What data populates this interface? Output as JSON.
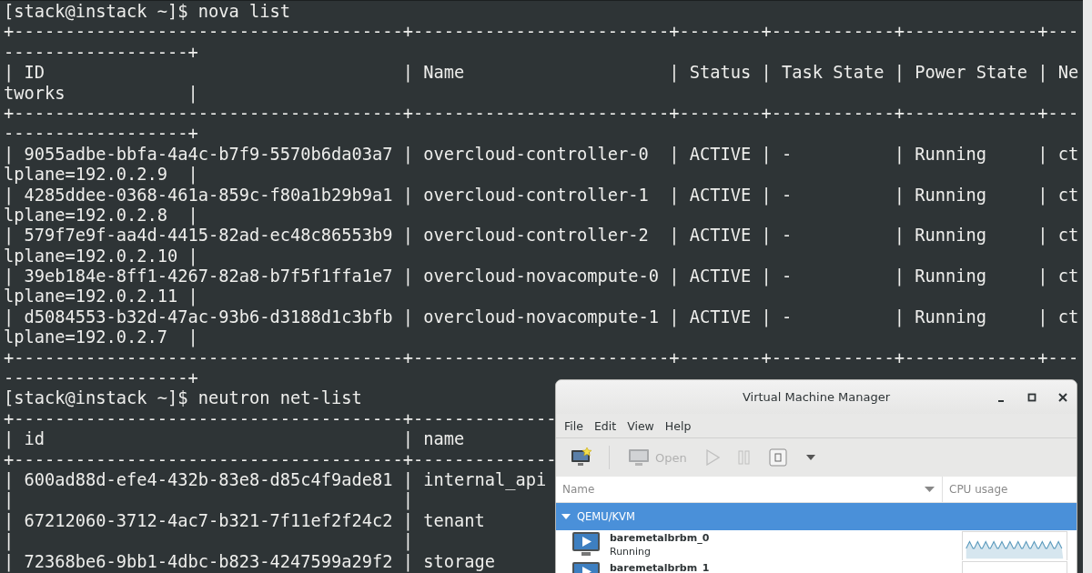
{
  "terminal": {
    "lines": [
      "[stack@instack ~]$ nova list",
      "+--------------------------------------+-------------------------+--------+------------+-------------+---",
      "------------------+",
      "| ID                                   | Name                    | Status | Task State | Power State | Ne",
      "tworks            |",
      "+--------------------------------------+-------------------------+--------+------------+-------------+---",
      "------------------+",
      "| 9055adbe-bbfa-4a4c-b7f9-5570b6da03a7 | overcloud-controller-0  | ACTIVE | -          | Running     | ct",
      "lplane=192.0.2.9  |",
      "| 4285ddee-0368-461a-859c-f80a1b29b9a1 | overcloud-controller-1  | ACTIVE | -          | Running     | ct",
      "lplane=192.0.2.8  |",
      "| 579f7e9f-aa4d-4415-82ad-ec48c86553b9 | overcloud-controller-2  | ACTIVE | -          | Running     | ct",
      "lplane=192.0.2.10 |",
      "| 39eb184e-8ff1-4267-82a8-b7f5f1ffa1e7 | overcloud-novacompute-0 | ACTIVE | -          | Running     | ct",
      "lplane=192.0.2.11 |",
      "| d5084553-b32d-47ac-93b6-d3188d1c3bfb | overcloud-novacompute-1 | ACTIVE | -          | Running     | ct",
      "lplane=192.0.2.7  |",
      "+--------------------------------------+-------------------------+--------+------------+-------------+---",
      "------------------+",
      "[stack@instack ~]$ neutron net-list",
      "+--------------------------------------+--------------",
      "| id                                   | name",
      "+--------------------------------------+--------------",
      "| 600ad88d-efe4-432b-83e8-d85c4f9ade81 | internal_api",
      "|                                      |",
      "| 67212060-3712-4ac7-b321-7f11ef2f24c2 | tenant",
      "|                                      |",
      "| 72368be6-9bb1-4dbc-b823-4247599a29f2 | storage"
    ]
  },
  "vmm_window": {
    "title": "Virtual Machine Manager",
    "menu": [
      "File",
      "Edit",
      "View",
      "Help"
    ],
    "toolbar": [
      {
        "kind": "new",
        "disabled": false
      },
      {
        "kind": "open",
        "label": "Open",
        "disabled": true
      },
      {
        "kind": "run",
        "disabled": true
      },
      {
        "kind": "pause",
        "disabled": true
      },
      {
        "kind": "shutdown",
        "disabled": false
      },
      {
        "kind": "menu",
        "disabled": false
      }
    ],
    "columns": [
      "Name",
      "CPU usage"
    ],
    "group": {
      "label": "QEMU/KVM",
      "expanded": true,
      "selected": true
    },
    "vms": [
      {
        "name": "baremetalbrbm_0",
        "status": "Running",
        "selected": false
      },
      {
        "name": "baremetalbrbm_1",
        "selected": false
      }
    ]
  }
}
